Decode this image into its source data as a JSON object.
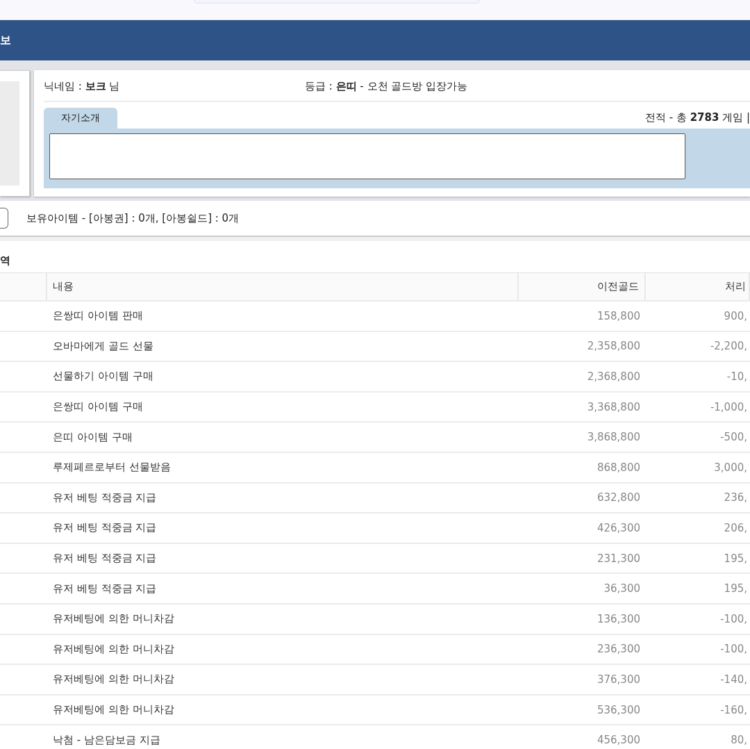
{
  "header": {
    "title": "보"
  },
  "profile": {
    "nickname": "닉네임 : **보크** 님",
    "grade": "등급 : **은띠** - 오천 골드방 입장가능",
    "tabs": [
      {
        "label": "자기소개",
        "selected": true
      }
    ],
    "record": "전적 - 총 **2783** 게임 |"
  },
  "items": {
    "text": "보유아이템 - [아봉권] : 0개, [아봉쉴드] : 0개"
  },
  "history": {
    "title": "역",
    "columns": [
      "내용",
      "이전골드",
      "처리"
    ],
    "rows": [
      {
        "content": "은쌍띠 아이템 판매",
        "previous": "158,800",
        "amount": "900,"
      },
      {
        "content": "오바마에게 골드 선물",
        "previous": "2,358,800",
        "amount": "-2,200,"
      },
      {
        "content": "선물하기 아이템 구매",
        "previous": "2,368,800",
        "amount": "-10,"
      },
      {
        "content": "은쌍띠 아이템 구매",
        "previous": "3,368,800",
        "amount": "-1,000,"
      },
      {
        "content": "은띠 아이템 구매",
        "previous": "3,868,800",
        "amount": "-500,"
      },
      {
        "content": "루제페르로부터 선물받음",
        "previous": "868,800",
        "amount": "3,000,"
      },
      {
        "content": "유저 베팅 적중금 지급",
        "previous": "632,800",
        "amount": "236,"
      },
      {
        "content": "유저 베팅 적중금 지급",
        "previous": "426,300",
        "amount": "206,"
      },
      {
        "content": "유저 베팅 적중금 지급",
        "previous": "231,300",
        "amount": "195,"
      },
      {
        "content": "유저 베팅 적중금 지급",
        "previous": "36,300",
        "amount": "195,"
      },
      {
        "content": "유저베팅에 의한 머니차감",
        "previous": "136,300",
        "amount": "-100,"
      },
      {
        "content": "유저베팅에 의한 머니차감",
        "previous": "236,300",
        "amount": "-100,"
      },
      {
        "content": "유저베팅에 의한 머니차감",
        "previous": "376,300",
        "amount": "-140,"
      },
      {
        "content": "유저베팅에 의한 머니차감",
        "previous": "536,300",
        "amount": "-160,"
      },
      {
        "content": "낙첨 - 남은담보금 지급",
        "previous": "456,300",
        "amount": "80,"
      }
    ]
  }
}
